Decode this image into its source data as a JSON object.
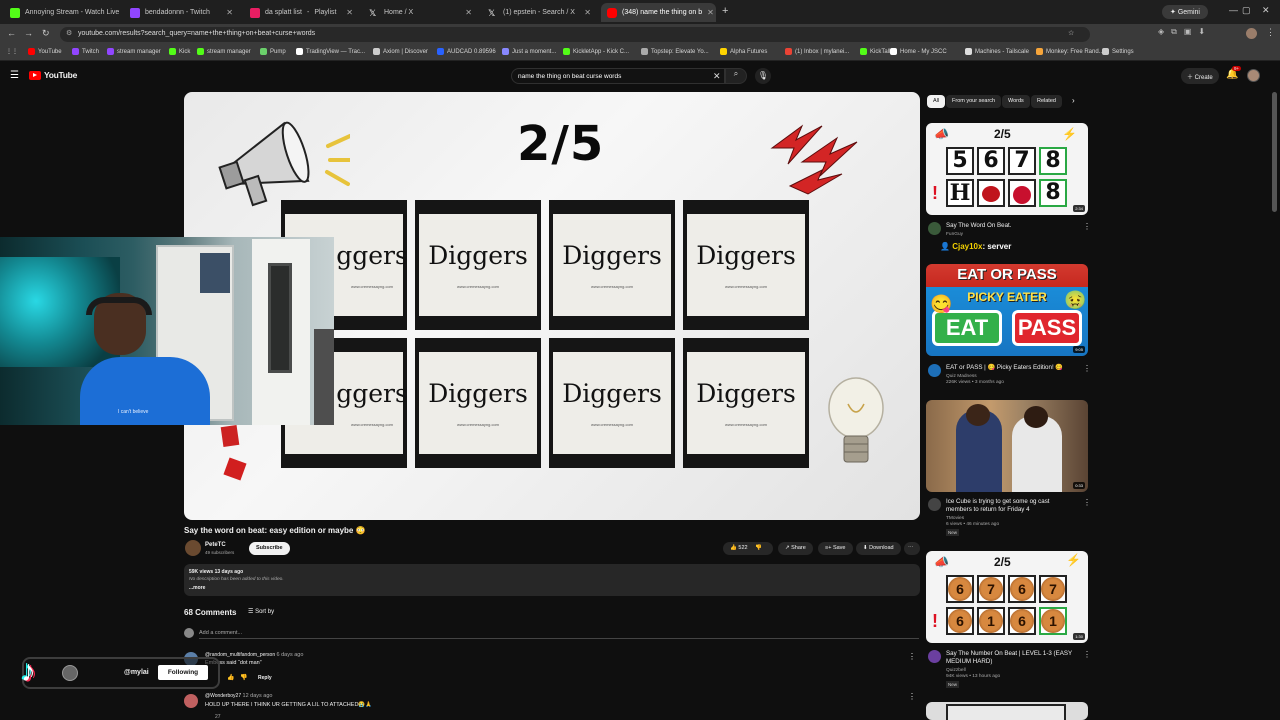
{
  "tabs": [
    {
      "label": "Annoying Stream - Watch Live",
      "color": "#53fc18"
    },
    {
      "label": "bendadonnn - Twitch",
      "color": "#9146ff"
    },
    {
      "label": "da splatt list",
      "color": "#e91e63"
    },
    {
      "label": "Playlist",
      "color": ""
    },
    {
      "label": "Home / X",
      "color": "#ffffff"
    },
    {
      "label": "(1) epstein - Search / X",
      "color": "#ffffff"
    },
    {
      "label": "(348) name the thing on b",
      "color": "#ff0000"
    }
  ],
  "browser": {
    "gemini": "Gemini",
    "url": "youtube.com/results?search_query=name+the+thing+on+beat+curse+words"
  },
  "bookmarks": [
    {
      "label": "YouTube",
      "color": "#ff0000"
    },
    {
      "label": "Twitch",
      "color": "#9146ff"
    },
    {
      "label": "stream manager",
      "color": "#9146ff"
    },
    {
      "label": "Kick",
      "color": "#53fc18"
    },
    {
      "label": "stream manager",
      "color": "#53fc18"
    },
    {
      "label": "Pump",
      "color": "#6bd06b"
    },
    {
      "label": "TradingView — Trac...",
      "color": "#ffffff"
    },
    {
      "label": "Axiom | Discover",
      "color": "#cccccc"
    },
    {
      "label": "AUDCAD 0.89596",
      "color": "#2962ff"
    },
    {
      "label": "Just a moment...",
      "color": "#8888ff"
    },
    {
      "label": "KickletApp - Kick C...",
      "color": "#53fc18"
    },
    {
      "label": "Topstep: Elevate Yo...",
      "color": "#aaaaaa"
    },
    {
      "label": "Alpha Futures",
      "color": "#ffd400"
    },
    {
      "label": "(1) Inbox | mylanei...",
      "color": "#ea4335"
    },
    {
      "label": "KickTalk",
      "color": "#53fc18"
    },
    {
      "label": "Home - My JSCC",
      "color": "#ffffff"
    },
    {
      "label": "Machines - Tailscale",
      "color": "#dddddd"
    },
    {
      "label": "Monkey: Free Rand...",
      "color": "#f6a53a"
    },
    {
      "label": "Settings",
      "color": "#cccccc"
    }
  ],
  "youtube": {
    "logo": "YouTube",
    "search_query": "name the thing on beat curse words",
    "create": "Create",
    "notif_count": "9+"
  },
  "video": {
    "counter": "2/5",
    "cards": [
      "Diggers",
      "Diggers",
      "Diggers",
      "Diggers",
      "Diggers",
      "Diggers",
      "Diggers",
      "Diggers"
    ],
    "card_site": "www.cremessayng.com",
    "partial_word": "ggers",
    "title": "Say the word on beat: easy edition or maybe 😳",
    "channel": "PeteTC",
    "subscribers": "49 subscribers",
    "subscribe": "Subscribe",
    "likes": "522",
    "share": "Share",
    "save": "Save",
    "download": "Download",
    "views": "59K views  13 days ago",
    "description": "No description has been added to this video.",
    "more": "...more",
    "comments_count": "68 Comments",
    "sort": "Sort by",
    "add_comment": "Add a comment...",
    "comments": [
      {
        "user": "@random_multifandom_person",
        "time": "6 days ago",
        "text": "Embess said “dot man”",
        "reply": "Reply"
      },
      {
        "user": "@Wonderboy27",
        "time": "12 days ago",
        "text": "HOLD UP THERE I THINK UR GETTING A LIL TO ATTACHED😭🙏",
        "likes": "27"
      }
    ]
  },
  "overlay": {
    "tiktok_handle": "@mylai",
    "following": "Following",
    "shirt_text": "I can't believe"
  },
  "sidebar": {
    "chips": [
      "All",
      "From your search",
      "Words",
      "Related"
    ],
    "videos": [
      {
        "title": "Say The Word On Beat.",
        "channel": "FunGuy",
        "chat_user": "Cjay10x",
        "chat_msg": ": server",
        "duration": "2:34",
        "counter": "2/5",
        "numbers": [
          "5",
          "6",
          "7",
          "8"
        ],
        "row2": [
          "H",
          "",
          "",
          "8"
        ]
      },
      {
        "title": "EAT or PASS | 😋 Picky Eaters Edition! 😋",
        "channel": "Quiz Madness",
        "meta": "226K views • 3 months ago",
        "duration": "9:05",
        "headline": "EAT OR PASS",
        "sub": "PICKY EATER",
        "eat": "EAT",
        "pass": "PASS"
      },
      {
        "title": "Ice Cube is trying to get some og cast members to return for Friday 4",
        "channel": "TMovies",
        "meta": "6 views • 46 minutes ago",
        "badge": "New",
        "duration": "0:33"
      },
      {
        "title": "Say The Number On Beat | LEVEL 1-3 (EASY MEDIUM HARD)",
        "channel": "Quizzbell",
        "meta": "94K views • 13 hours ago",
        "badge": "New",
        "duration": "1:30",
        "counter": "2/5",
        "row1": [
          "6",
          "7",
          "6",
          "7"
        ],
        "row2": [
          "6",
          "1",
          "6",
          "1"
        ]
      }
    ]
  },
  "colors": {
    "accent_red": "#ff0000",
    "bg": "#0f0f0f",
    "card": "#272727"
  }
}
